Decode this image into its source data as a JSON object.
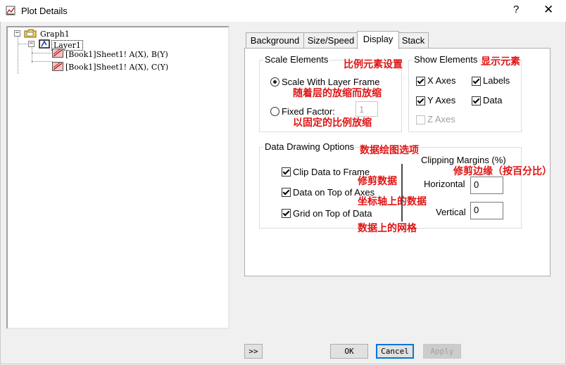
{
  "window": {
    "title": "Plot Details",
    "help_glyph": "?",
    "close_glyph": "✕"
  },
  "tree": {
    "root": "Graph1",
    "layer": "Layer1",
    "plots": [
      "[Book1]Sheet1! A(X), B(Y)",
      "[Book1]Sheet1! A(X), C(Y)"
    ]
  },
  "tabs": [
    "Background",
    "Size/Speed",
    "Display",
    "Stack"
  ],
  "active_tab": "Display",
  "scale_elements": {
    "legend": "Scale Elements",
    "annotation": "比例元素设置",
    "scale_with_frame": "Scale With Layer Frame",
    "scale_with_frame_annotation": "随着层的放缩而放缩",
    "fixed_factor": "Fixed Factor:",
    "fixed_factor_value": "1",
    "fixed_factor_annotation": "以固定的比例放缩"
  },
  "show_elements": {
    "legend": "Show Elements",
    "annotation": "显示元素",
    "x_axes": "X Axes",
    "labels": "Labels",
    "y_axes": "Y Axes",
    "data": "Data",
    "z_axes": "Z Axes"
  },
  "data_drawing": {
    "legend": "Data Drawing Options",
    "annotation": "数据绘图选项",
    "clip_data": "Clip Data to Frame",
    "clip_data_annotation": "修剪数据",
    "data_on_top": "Data on Top of Axes",
    "data_on_top_annotation": "坐标轴上的数据",
    "grid_on_top": "Grid on Top of Data",
    "grid_on_top_annotation": "数据上的网格",
    "clipping_margins": "Clipping Margins (%)",
    "clipping_margins_annotation": "修剪边缘（按百分比）",
    "horizontal": "Horizontal",
    "horizontal_value": "0",
    "vertical": "Vertical",
    "vertical_value": "0"
  },
  "buttons": {
    "expand": ">>",
    "ok": "OK",
    "cancel": "Cancel",
    "apply": "Apply"
  },
  "colors": {
    "annotation": "#e01414",
    "default_button_border": "#0078d7"
  }
}
